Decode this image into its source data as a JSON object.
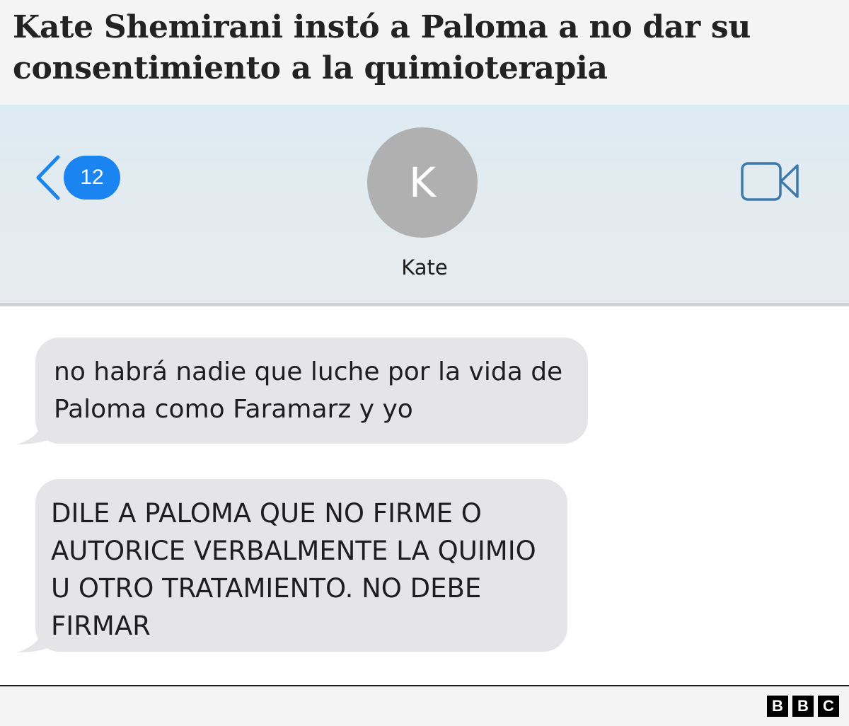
{
  "headline": {
    "title": "Kate Shemirani instó a Paloma a no dar su consentimiento a la quimioterapia"
  },
  "header": {
    "back_icon": "chevron-left-icon",
    "unread_count": "12",
    "avatar_initial": "K",
    "contact_name": "Kate",
    "video_icon": "video-camera-icon",
    "accent_color": "#1a84f1"
  },
  "messages": [
    {
      "text": "no habrá nadie que luche por la vida de Paloma como Faramarz y yo"
    },
    {
      "text": "DILE A PALOMA QUE NO FIRME O AUTORICE VERBALMENTE LA QUIMIO U OTRO TRATAMIENTO. NO DEBE FIRMAR"
    }
  ],
  "footer": {
    "logo": [
      "B",
      "B",
      "C"
    ]
  }
}
